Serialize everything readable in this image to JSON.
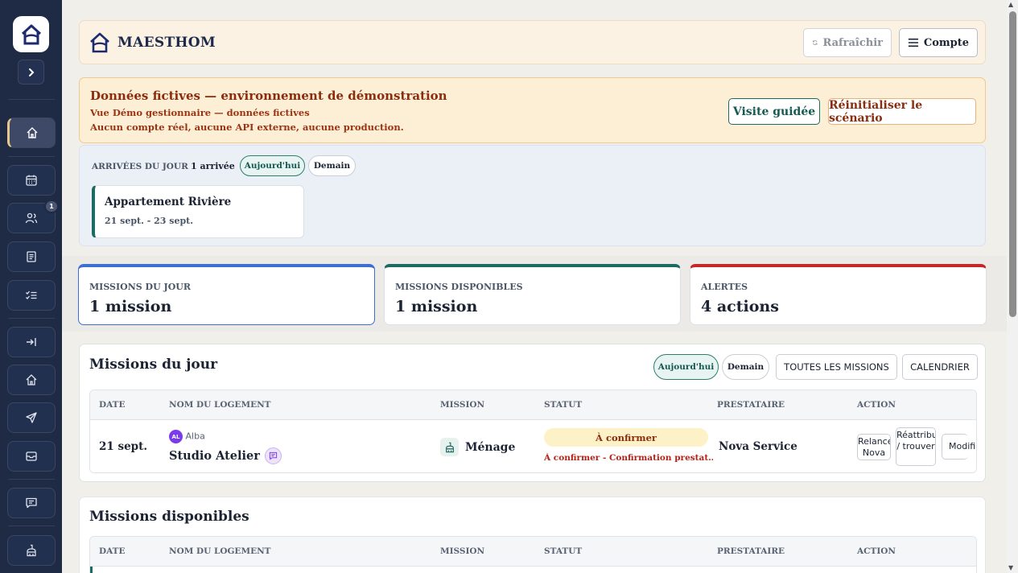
{
  "sidebar": {
    "logo": "house-logo-icon",
    "items": [
      {
        "icon": "home-icon",
        "active": true
      },
      {
        "icon": "calendar-icon"
      },
      {
        "icon": "users-icon",
        "badge": "1"
      },
      {
        "icon": "document-icon"
      },
      {
        "icon": "checklist-icon"
      },
      {
        "icon": "login-arrow-icon"
      },
      {
        "icon": "house-icon"
      },
      {
        "icon": "send-icon"
      },
      {
        "icon": "inbox-icon"
      },
      {
        "icon": "message-icon"
      },
      {
        "icon": "cleaning-icon"
      }
    ]
  },
  "header": {
    "brand": "MAESTHOM",
    "refresh_label": "Rafraîchir",
    "account_label": "Compte"
  },
  "demo": {
    "title": "Données fictives — environnement de démonstration",
    "line1": "Vue Démo gestionnaire — données fictives",
    "line2": "Aucun compte réel, aucune API externe, aucune production.",
    "guided_label": "Visite guidée",
    "reset_label": "Réinitialiser le scénario"
  },
  "arrivals": {
    "label": "ARRIVÉES DU JOUR",
    "count": "1 arrivée",
    "today": "Aujourd'hui",
    "tomorrow": "Demain",
    "item": {
      "title": "Appartement Rivière",
      "dates": "21 sept. - 23 sept."
    }
  },
  "stats": [
    {
      "label": "MISSIONS DU JOUR",
      "value": "1 mission",
      "color": "#3b6fd4"
    },
    {
      "label": "MISSIONS DISPONIBLES",
      "value": "1 mission",
      "color": "#1b6b63"
    },
    {
      "label": "ALERTES",
      "value": "4 actions",
      "color": "#c62828"
    }
  ],
  "missions_today": {
    "title": "Missions du jour",
    "today": "Aujourd'hui",
    "tomorrow": "Demain",
    "all_label": "TOUTES LES MISSIONS",
    "calendar_label": "CALENDRIER",
    "columns": [
      "DATE",
      "NOM DU LOGEMENT",
      "MISSION",
      "STATUT",
      "PRESTATAIRE",
      "ACTION"
    ],
    "row": {
      "date": "21 sept.",
      "avatar_initials": "AL",
      "owner": "Alba",
      "property": "Studio Atelier",
      "mission": "Ménage",
      "status": "À confirmer",
      "status_detail": "À confirmer - Confirmation prestat…",
      "provider": "Nova Service",
      "actions": [
        "Relancer Nova",
        "Réattribuer / trouver",
        "Modifier"
      ]
    }
  },
  "missions_available": {
    "title": "Missions disponibles",
    "columns": [
      "DATE",
      "NOM DU LOGEMENT",
      "MISSION",
      "STATUT",
      "PRESTATAIRE",
      "ACTION"
    ]
  }
}
